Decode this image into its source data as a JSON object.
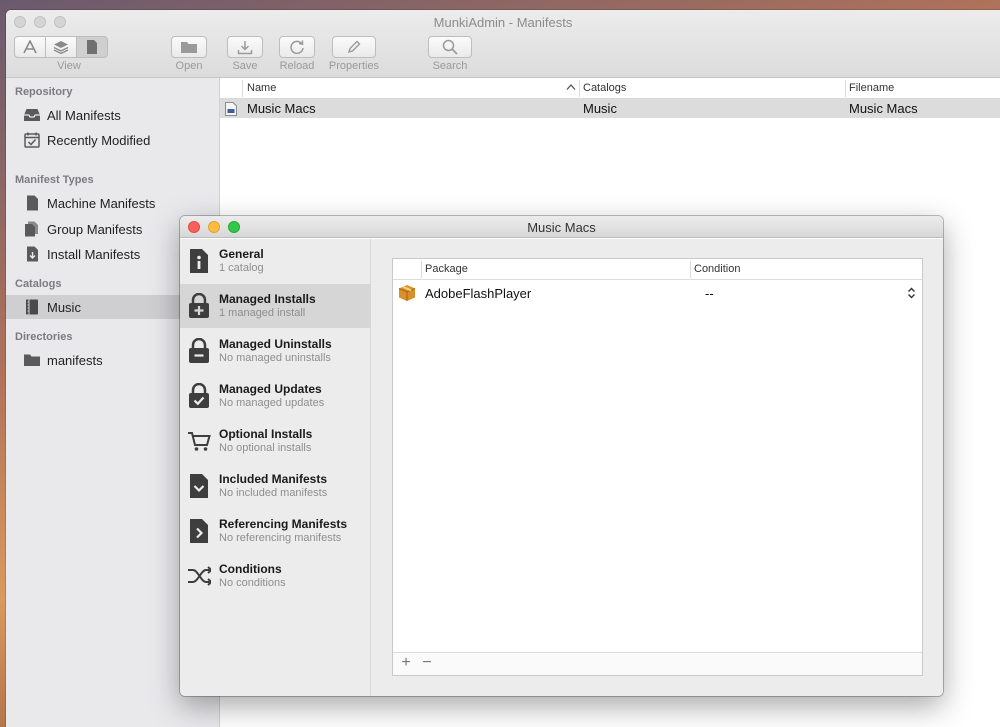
{
  "window": {
    "title": "MunkiAdmin - Manifests"
  },
  "toolbar": {
    "view_label": "View",
    "open_label": "Open",
    "save_label": "Save",
    "reload_label": "Reload",
    "properties_label": "Properties",
    "search_label": "Search"
  },
  "sidebar": {
    "repository_header": "Repository",
    "all_manifests": "All Manifests",
    "recently_modified": "Recently Modified",
    "manifest_types_header": "Manifest Types",
    "machine_manifests": "Machine Manifests",
    "group_manifests": "Group Manifests",
    "install_manifests": "Install Manifests",
    "catalogs_header": "Catalogs",
    "music": "Music",
    "directories_header": "Directories",
    "manifests_dir": "manifests"
  },
  "manifest_table": {
    "columns": {
      "name": "Name",
      "catalogs": "Catalogs",
      "filename": "Filename"
    },
    "rows": [
      {
        "name": "Music Macs",
        "catalogs": "Music",
        "filename": "Music Macs"
      }
    ]
  },
  "sheet": {
    "title": "Music Macs",
    "nav": [
      {
        "title": "General",
        "subtitle": "1 catalog"
      },
      {
        "title": "Managed Installs",
        "subtitle": "1 managed install"
      },
      {
        "title": "Managed Uninstalls",
        "subtitle": "No managed uninstalls"
      },
      {
        "title": "Managed Updates",
        "subtitle": "No managed updates"
      },
      {
        "title": "Optional Installs",
        "subtitle": "No optional installs"
      },
      {
        "title": "Included Manifests",
        "subtitle": "No included manifests"
      },
      {
        "title": "Referencing Manifests",
        "subtitle": "No referencing manifests"
      },
      {
        "title": "Conditions",
        "subtitle": "No conditions"
      }
    ],
    "packages": {
      "columns": {
        "package": "Package",
        "condition": "Condition"
      },
      "rows": [
        {
          "package": "AdobeFlashPlayer",
          "condition": "--"
        }
      ],
      "add": "+",
      "remove": "−"
    }
  },
  "colors": {
    "close": "#fc605c",
    "minimize": "#fdbc40",
    "zoom": "#34c84a"
  }
}
